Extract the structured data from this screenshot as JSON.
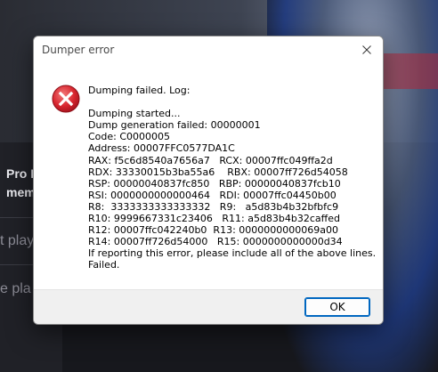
{
  "background_app": {
    "partial_title_line1": "Pro E",
    "partial_title_line2": "mem",
    "partial_item_1": "t play",
    "partial_item_2": "e pla"
  },
  "dialog": {
    "title": "Dumper error",
    "icon": "error-icon",
    "message_lines": [
      "Dumping failed. Log:",
      "",
      "Dumping started...",
      "Dump generation failed: 00000001",
      "Code: C0000005",
      "Address: 00007FFC0577DA1C",
      "RAX: f5c6d8540a7656a7   RCX: 00007ffc049ffa2d",
      "RDX: 33330015b3ba55a6    RBX: 00007ff726d54058",
      "RSP: 00000040837fc850   RBP: 00000040837fcb10",
      "RSI: 0000000000000464   RDI: 00007ffc04450b00",
      "R8:  3333333333333332   R9:   a5d83b4b32bfbfc9",
      "R10: 9999667331c23406   R11: a5d83b4b32caffed",
      "R12: 00007ffc042240b0  R13: 0000000000069a00",
      "R14: 00007ff726d54000   R15: 0000000000000d34",
      "If reporting this error, please include all of the above lines.",
      "Failed."
    ],
    "ok_label": "OK"
  },
  "colors": {
    "accent": "#0067c0",
    "error_red": "#e0303a"
  }
}
